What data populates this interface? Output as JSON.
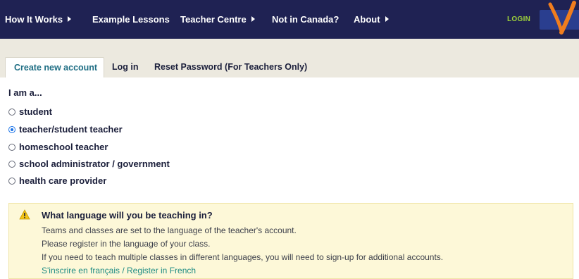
{
  "nav": {
    "items": [
      {
        "label": "How It Works",
        "has_caret": true
      },
      {
        "label": "Example Lessons",
        "has_caret": false
      },
      {
        "label": "Teacher Centre",
        "has_caret": true
      },
      {
        "label": "Not in Canada?",
        "has_caret": false
      },
      {
        "label": "About",
        "has_caret": true
      }
    ],
    "login_label": "LOGIN"
  },
  "tabs": [
    {
      "label": "Create new account",
      "active": true
    },
    {
      "label": "Log in",
      "active": false
    },
    {
      "label": "Reset Password (For Teachers Only)",
      "active": false
    }
  ],
  "form": {
    "heading": "I am a...",
    "options": [
      {
        "label": "student",
        "checked": false
      },
      {
        "label": "teacher/student teacher",
        "checked": true
      },
      {
        "label": "homeschool teacher",
        "checked": false
      },
      {
        "label": "school administrator / government",
        "checked": false
      },
      {
        "label": "health care provider",
        "checked": false
      }
    ]
  },
  "notice": {
    "title": "What language will you be teaching in?",
    "lines": [
      "Teams and classes are set to the language of the teacher's account.",
      "Please register in the language of your class.",
      "If you need to teach multiple classes in different languages, you will need to sign-up for additional accounts."
    ],
    "link": "S'inscrire en français / Register in French"
  },
  "colors": {
    "nav_bg": "#1f2253",
    "login": "#9fd33a",
    "active_tab": "#1f6e84",
    "arrow": "#f07d1e",
    "notice_bg": "#fdf8d8",
    "link": "#1e8c84"
  },
  "icons": {
    "caret": "caret-right-icon",
    "warning": "warning-icon",
    "arrow": "arrow-annotation-icon"
  }
}
